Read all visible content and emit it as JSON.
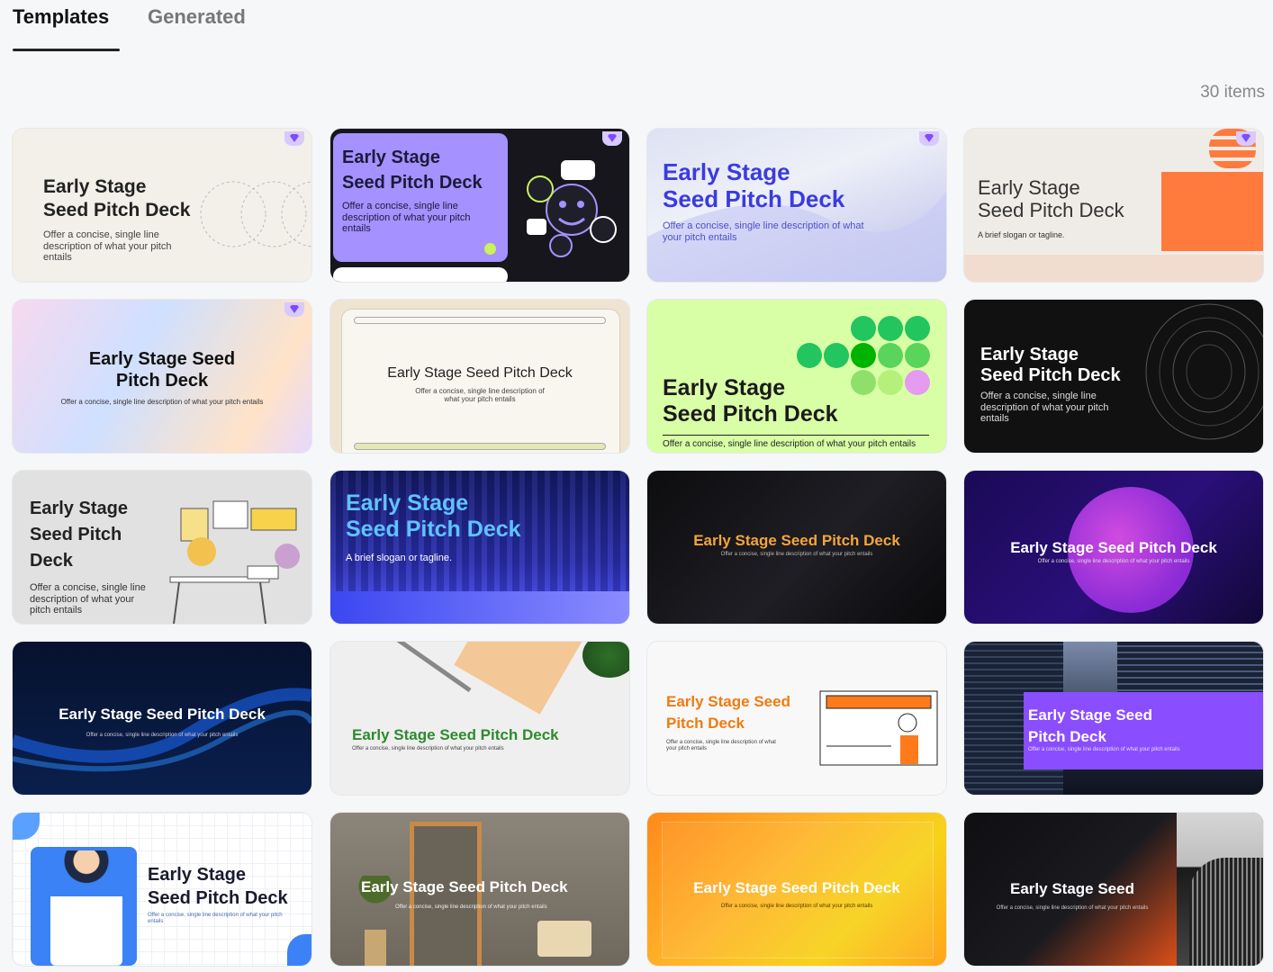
{
  "tabs": {
    "templates": "Templates",
    "generated": "Generated"
  },
  "items_count": "30 items",
  "cards": [
    {
      "title": "Early Stage\nSeed Pitch Deck",
      "subtitle": "Offer a concise, single line\ndescription of what your pitch\nentails",
      "premium": true
    },
    {
      "title": "Early Stage\nSeed Pitch Deck",
      "subtitle": "Offer a concise, single line\ndescription of what your pitch\nentails",
      "premium": true
    },
    {
      "title": "Early Stage\nSeed Pitch Deck",
      "subtitle": "Offer a concise, single line description of what\nyour pitch entails",
      "premium": true
    },
    {
      "title": "Early Stage\nSeed Pitch Deck",
      "subtitle": "A brief slogan or tagline.",
      "premium": true
    },
    {
      "title": "Early Stage Seed\nPitch Deck",
      "subtitle": "Offer a concise, single line description of what your pitch entails",
      "premium": true
    },
    {
      "title": "Early Stage Seed Pitch Deck",
      "subtitle": "Offer a concise, single line description of\nwhat your pitch entails",
      "premium": false
    },
    {
      "title": "Early Stage\nSeed Pitch Deck",
      "subtitle": "Offer a concise, single line description of what your pitch entails",
      "premium": false
    },
    {
      "title": "Early Stage\nSeed Pitch Deck",
      "subtitle": "Offer a concise, single line\ndescription of what your pitch\nentails",
      "premium": false
    },
    {
      "title": "Early Stage\nSeed Pitch\nDeck",
      "subtitle": "Offer a concise, single line\ndescription of what your\npitch entails",
      "premium": false
    },
    {
      "title": "Early Stage\nSeed Pitch Deck",
      "subtitle": "A brief slogan or tagline.",
      "premium": false
    },
    {
      "title": "Early Stage Seed Pitch Deck",
      "subtitle": "Offer a concise, single line description of what your pitch entails",
      "premium": false
    },
    {
      "title": "Early Stage Seed Pitch Deck",
      "subtitle": "Offer a concise, single line description of what your pitch entails",
      "premium": false
    },
    {
      "title": "Early Stage Seed Pitch Deck",
      "subtitle": "Offer a concise, single line description of what your pitch entails",
      "premium": false
    },
    {
      "title": "Early Stage Seed Pitch Deck",
      "subtitle": "Offer a concise, single line description of what your pitch entails",
      "premium": false
    },
    {
      "title": "Early Stage Seed\nPitch Deck",
      "subtitle": "Offer a concise, single line description of what\nyour pitch entails",
      "premium": false
    },
    {
      "title": "Early Stage Seed\nPitch Deck",
      "subtitle": "Offer a concise, single line description of what your pitch entails",
      "premium": false
    },
    {
      "title": "Early Stage\nSeed Pitch Deck",
      "subtitle": "Offer a concise, single line description of what your pitch\nentails",
      "premium": false
    },
    {
      "title": "Early Stage Seed Pitch Deck",
      "subtitle": "Offer a concise, single line description of what your pitch entails",
      "premium": false
    },
    {
      "title": "Early Stage Seed Pitch Deck",
      "subtitle": "Offer a concise, single line description of what your pitch entails",
      "premium": false
    },
    {
      "title": "Early Stage Seed",
      "subtitle": "Offer a concise, single line description of what your pitch entails",
      "premium": false
    }
  ]
}
